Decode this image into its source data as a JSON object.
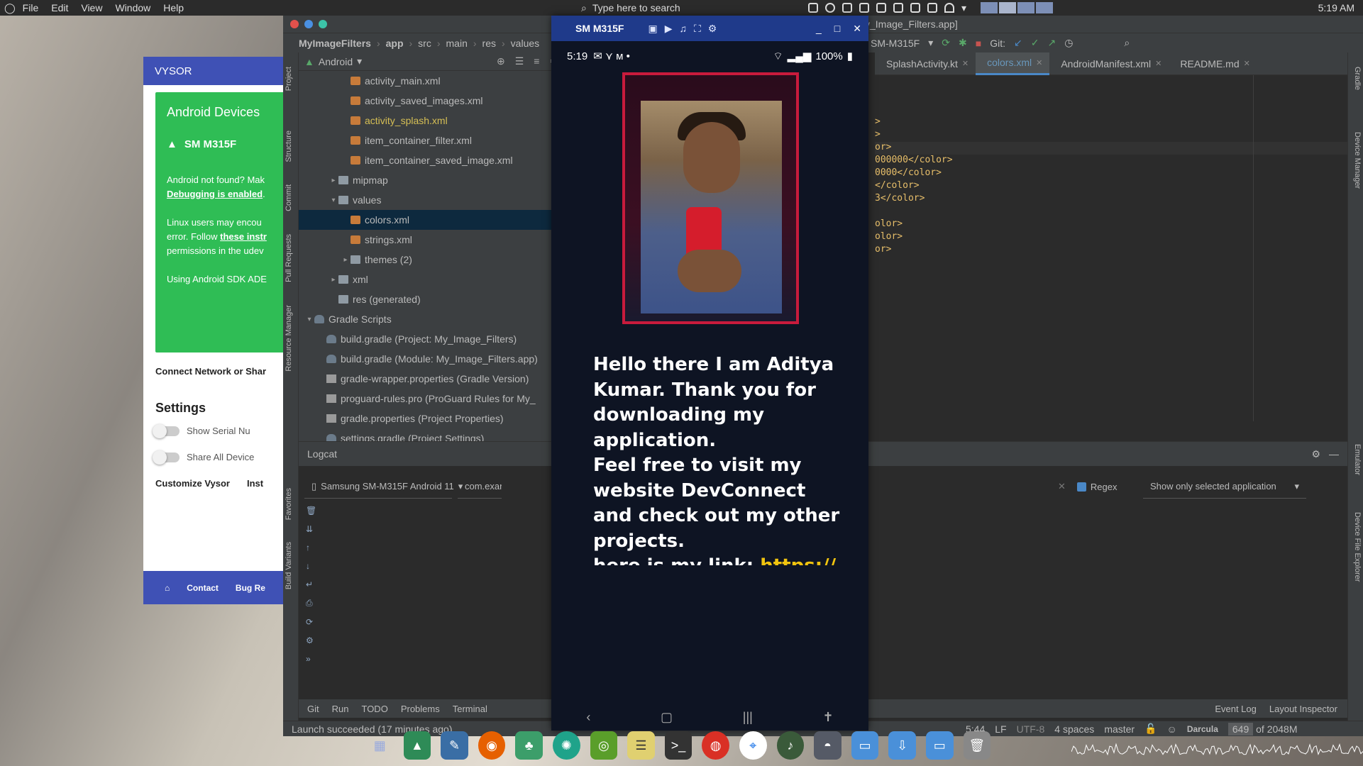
{
  "topbar": {
    "menu": [
      "File",
      "Edit",
      "View",
      "Window",
      "Help"
    ],
    "search_placeholder": "Type here to search",
    "clock": "5:19 AM"
  },
  "vysor": {
    "title": "VYSOR",
    "devices_heading": "Android Devices",
    "device_name": "SM M315F",
    "not_found": "Android not found? Mak",
    "debugging_link": "Debugging is enabled",
    "linux_1": "Linux users may encou",
    "linux_2_prefix": "error. Follow ",
    "linux_link": "these instr",
    "linux_3": "permissions in the udev",
    "sdk": "Using Android SDK ADE",
    "connect": "Connect Network or Shar",
    "settings_heading": "Settings",
    "toggle_serial": "Show Serial Nu",
    "toggle_share": "Share All Device",
    "customize": "Customize Vysor",
    "inst": "Inst",
    "footer": [
      "Contact",
      "Bug Re"
    ]
  },
  "ide": {
    "window_title": "y_Image_Filters.app]",
    "breadcrumb": [
      "MyImageFilters",
      "app",
      "src",
      "main",
      "res",
      "values"
    ],
    "run_device": "SM-M315F",
    "git_label": "Git:",
    "left_tools": [
      "Project",
      "Structure",
      "Commit",
      "Pull Requests",
      "Resource Manager",
      "Favorites",
      "Build Variants"
    ],
    "right_tools": [
      "Gradle",
      "Device Manager",
      "Emulator",
      "Device File Explorer"
    ],
    "project_view": "Android",
    "tree": [
      {
        "label": "activity_main.xml",
        "indent": 3,
        "icon": "xml",
        "style": ""
      },
      {
        "label": "activity_saved_images.xml",
        "indent": 3,
        "icon": "xml",
        "style": ""
      },
      {
        "label": "activity_splash.xml",
        "indent": 3,
        "icon": "xml",
        "style": "yellow"
      },
      {
        "label": "item_container_filter.xml",
        "indent": 3,
        "icon": "xml",
        "style": ""
      },
      {
        "label": "item_container_saved_image.xml",
        "indent": 3,
        "icon": "xml",
        "style": ""
      },
      {
        "label": "mipmap",
        "indent": 2,
        "icon": "folder",
        "arrow": "▸",
        "style": ""
      },
      {
        "label": "values",
        "indent": 2,
        "icon": "folder",
        "arrow": "▾",
        "style": ""
      },
      {
        "label": "colors.xml",
        "indent": 3,
        "icon": "xml",
        "style": "sel"
      },
      {
        "label": "strings.xml",
        "indent": 3,
        "icon": "xml",
        "style": ""
      },
      {
        "label": "themes (2)",
        "indent": 3,
        "icon": "folder",
        "arrow": "▸",
        "style": ""
      },
      {
        "label": "xml",
        "indent": 2,
        "icon": "folder",
        "arrow": "▸",
        "style": ""
      },
      {
        "label": "res (generated)",
        "indent": 2,
        "icon": "folder",
        "style": ""
      },
      {
        "label": "Gradle Scripts",
        "indent": 0,
        "icon": "gradle",
        "arrow": "▾",
        "style": ""
      },
      {
        "label": "build.gradle (Project: My_Image_Filters)",
        "indent": 1,
        "icon": "gradle",
        "style": ""
      },
      {
        "label": "build.gradle (Module: My_Image_Filters.app)",
        "indent": 1,
        "icon": "gradle",
        "style": ""
      },
      {
        "label": "gradle-wrapper.properties (Gradle Version)",
        "indent": 1,
        "icon": "prop",
        "style": ""
      },
      {
        "label": "proguard-rules.pro (ProGuard Rules for My_",
        "indent": 1,
        "icon": "prop",
        "style": ""
      },
      {
        "label": "gradle.properties (Project Properties)",
        "indent": 1,
        "icon": "prop",
        "style": ""
      },
      {
        "label": "settings.gradle (Project Settings)",
        "indent": 1,
        "icon": "gradle",
        "style": ""
      }
    ],
    "editor_tabs": [
      {
        "label": "SplashActivity.kt",
        "active": false
      },
      {
        "label": "colors.xml",
        "active": true
      },
      {
        "label": "AndroidManifest.xml",
        "active": false
      },
      {
        "label": "README.md",
        "active": false
      }
    ],
    "code_lines": [
      {
        "tag": ">",
        "text": ""
      },
      {
        "tag": ">",
        "text": ""
      },
      {
        "tag": "or>",
        "text": ""
      },
      {
        "tag": "",
        "text": "000000</color>"
      },
      {
        "tag": "",
        "text": "0000</color>"
      },
      {
        "tag": "",
        "text": "</color>"
      },
      {
        "tag": "",
        "text": "3</color>"
      },
      {
        "tag": "",
        "text": ""
      },
      {
        "tag": "olor>",
        "text": ""
      },
      {
        "tag": "olor>",
        "text": ""
      },
      {
        "tag": "or>",
        "text": ""
      }
    ],
    "logcat": {
      "title": "Logcat",
      "device": "Samsung SM-M315F Android 11",
      "package": "com.exan",
      "regex_label": "Regex",
      "filter": "Show only selected application"
    },
    "bottom_tabs": [
      "Git",
      "Run",
      "TODO",
      "Problems",
      "Terminal"
    ],
    "bottom_right": [
      "Event Log",
      "Layout Inspector"
    ],
    "status_message": "Launch succeeded (17 minutes ago)",
    "status": {
      "position": "5:44",
      "line_sep": "LF",
      "encoding": "UTF-8",
      "indent": "4 spaces",
      "branch": "master",
      "theme": "Darcula",
      "memory_used": "649",
      "memory_total": "of 2048M"
    }
  },
  "phone": {
    "window_title": "SM M315F",
    "status_time": "5:19",
    "battery": "100%",
    "message": "Hello there I am Aditya Kumar. Thank you for downloading my application.",
    "message_2": "Feel free to visit my website DevConnect and check out my other projects.",
    "message_3_prefix": "here is my link: ",
    "message_3_link": "https://"
  },
  "colors": {
    "ide_bg": "#2b2b2b",
    "ide_panel": "#3c3f41",
    "accent_blue": "#4a88c7",
    "vysor_green": "#2fbd55",
    "vysor_header": "#3f51b5",
    "phone_title": "#1f3a8a"
  }
}
